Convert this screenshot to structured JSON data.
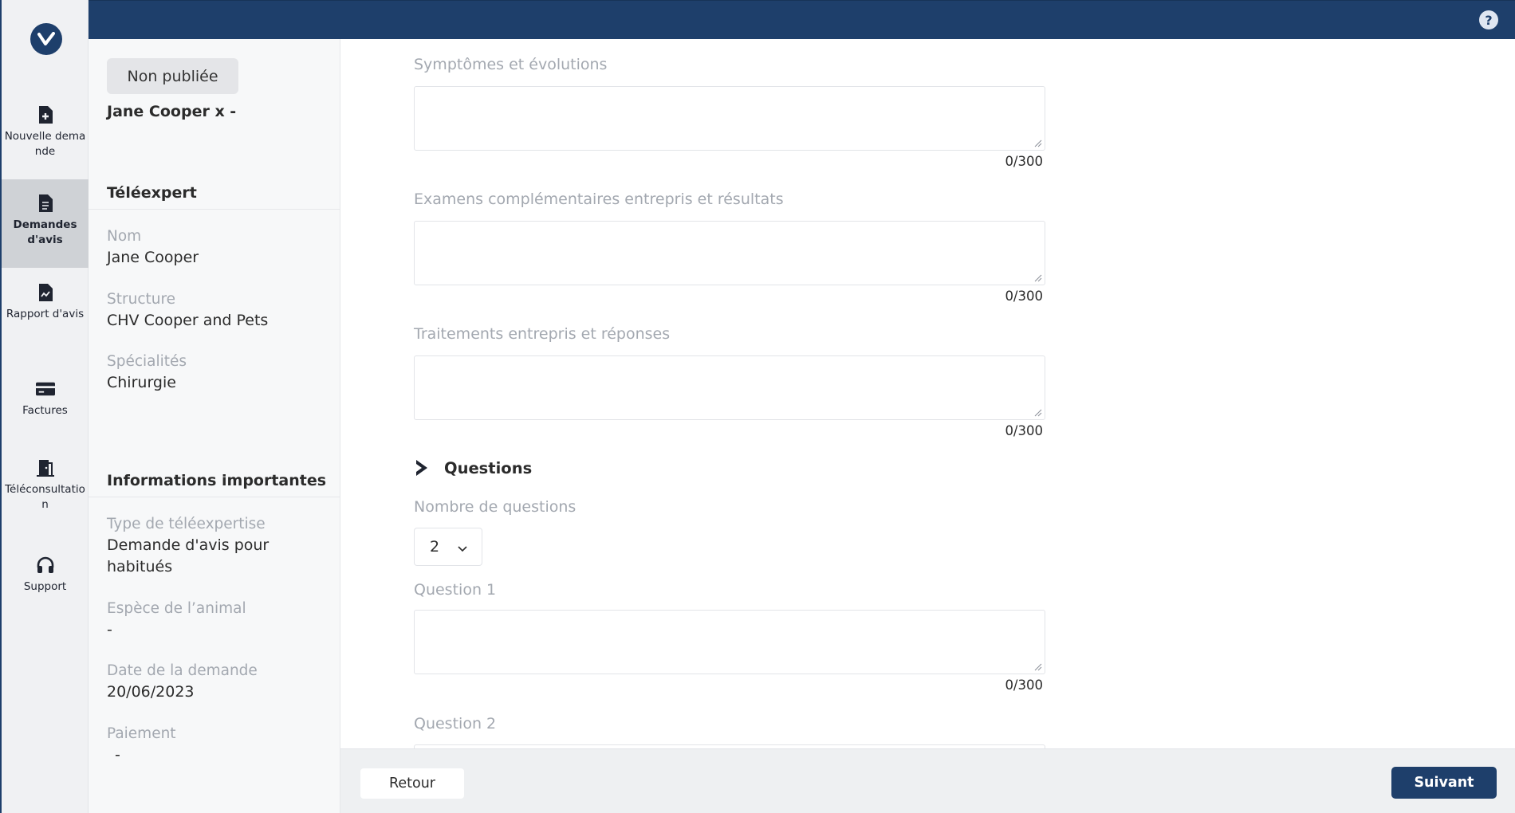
{
  "nav": {
    "items": [
      {
        "label": "Nouvelle demande",
        "icon": "file-plus-icon"
      },
      {
        "label": "Demandes d'avis",
        "icon": "document-icon",
        "active": true
      },
      {
        "label": "Rapport d'avis",
        "icon": "report-icon"
      },
      {
        "label": "Factures",
        "icon": "credit-card-icon"
      },
      {
        "label": "Téléconsultation",
        "icon": "door-icon"
      },
      {
        "label": "Support",
        "icon": "headset-icon"
      }
    ]
  },
  "topbar": {
    "help_label": "?"
  },
  "info": {
    "status_badge": "Non publiée",
    "owner": "Jane Cooper x -",
    "teleexpert": {
      "heading": "Téléexpert",
      "fields": [
        {
          "label": "Nom",
          "value": "Jane Cooper"
        },
        {
          "label": "Structure",
          "value": "CHV Cooper and Pets"
        },
        {
          "label": "Spécialités",
          "value": "Chirurgie"
        }
      ]
    },
    "important": {
      "heading": "Informations importantes",
      "fields": [
        {
          "label": "Type de téléexpertise",
          "value": "Demande d'avis pour habitués"
        },
        {
          "label": "Espèce de l’animal",
          "value": "-"
        },
        {
          "label": "Date de la demande",
          "value": "20/06/2023"
        },
        {
          "label": "Paiement",
          "value": "-"
        }
      ]
    }
  },
  "form": {
    "fields": [
      {
        "label": "Symptômes et évolutions",
        "value": "",
        "counter": "0/300"
      },
      {
        "label": "Examens complémentaires entrepris et résultats",
        "value": "",
        "counter": "0/300"
      },
      {
        "label": "Traitements entrepris et réponses",
        "value": "",
        "counter": "0/300"
      }
    ],
    "questions": {
      "title": "Questions",
      "count_label": "Nombre de questions",
      "count_value": "2",
      "items": [
        {
          "label": "Question 1",
          "value": "",
          "counter": "0/300"
        },
        {
          "label": "Question 2",
          "value": ""
        }
      ]
    }
  },
  "footer": {
    "back_label": "Retour",
    "next_label": "Suivant"
  },
  "colors": {
    "primary": "#1e3f6b",
    "muted_text": "#a3a8b0",
    "nav_active_bg": "#cfd2d6"
  }
}
